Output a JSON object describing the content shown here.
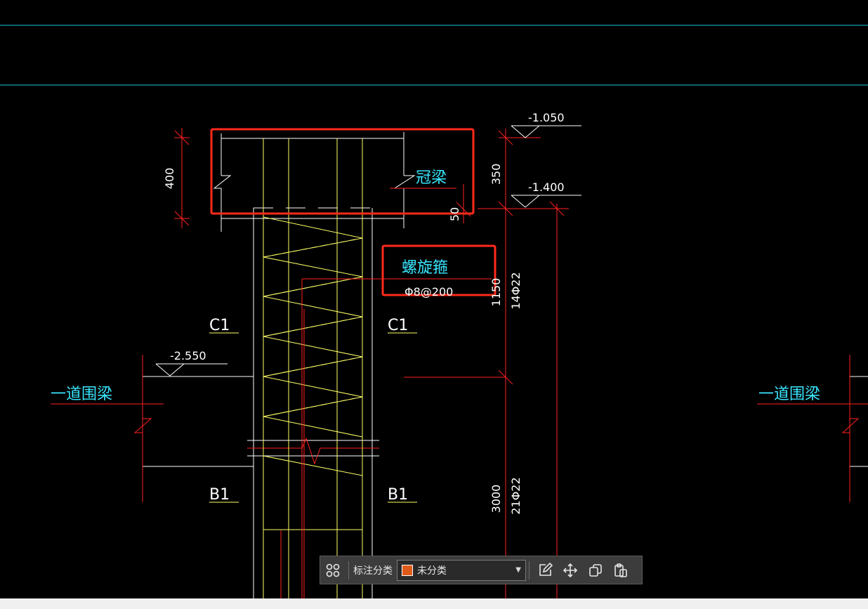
{
  "drawing": {
    "elevations": {
      "top": "-1.050",
      "beam_bottom": "-1.400",
      "waist_beam": "-2.550"
    },
    "dimensions": {
      "beam_height": "400",
      "top_offset": "350",
      "gap": "50",
      "upper_length": "1150",
      "lower_length": "3000"
    },
    "rebar": {
      "upper": "14Φ22",
      "lower": "21Φ22",
      "spiral_spec": "Φ8@200"
    },
    "notes": {
      "crown_beam": "冠梁",
      "spiral_stirrup": "螺旋箍",
      "waist_beam_left": "一道围梁",
      "waist_beam_right": "一道围梁"
    },
    "section_labels": {
      "c1_left": "C1",
      "c1_right": "C1",
      "b1_left": "B1",
      "b1_right": "B1"
    },
    "colors": {
      "background": "#000000",
      "outline": "#ffffff",
      "rebar": "#ffff66",
      "dimension": "#ff2020",
      "note": "#39e6ff",
      "highlight": "#ff2a1a",
      "grid": "#19c7d8"
    }
  },
  "toolbar": {
    "label": "标注分类",
    "category": {
      "selected": "未分类",
      "color": "#e05a1a"
    },
    "icons": {
      "layout": "grid-layout-icon",
      "edit": "edit-icon",
      "move": "move-icon",
      "copy": "copy-icon",
      "paste": "paste-icon"
    }
  }
}
